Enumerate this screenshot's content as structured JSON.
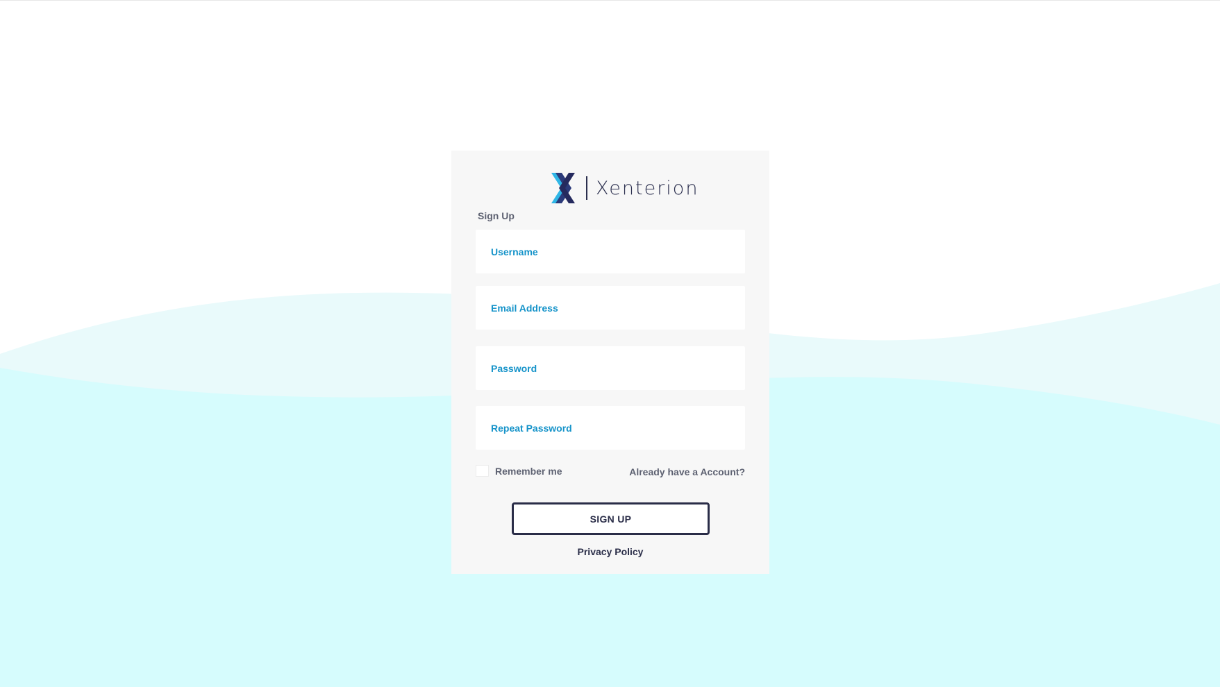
{
  "brand": {
    "name": "Xenterion",
    "icon": "xenterion-x-logo",
    "colors": {
      "dark": "#2b2f4e",
      "accent": "#1593c9",
      "light_accent": "#2fb6e6"
    }
  },
  "form": {
    "title": "Sign Up",
    "fields": {
      "username_label": "Username",
      "email_label": "Email Address",
      "password_label": "Password",
      "repeat_password_label": "Repeat Password"
    },
    "remember_label": "Remember me",
    "account_link": "Already have a Account?",
    "submit_label": "SIGN UP",
    "privacy_label": "Privacy Policy"
  },
  "theme": {
    "background": "#ffffff",
    "wave_light": "#e9fafb",
    "wave_main": "#d6fcfd",
    "card_background": "#f7f7f7"
  }
}
